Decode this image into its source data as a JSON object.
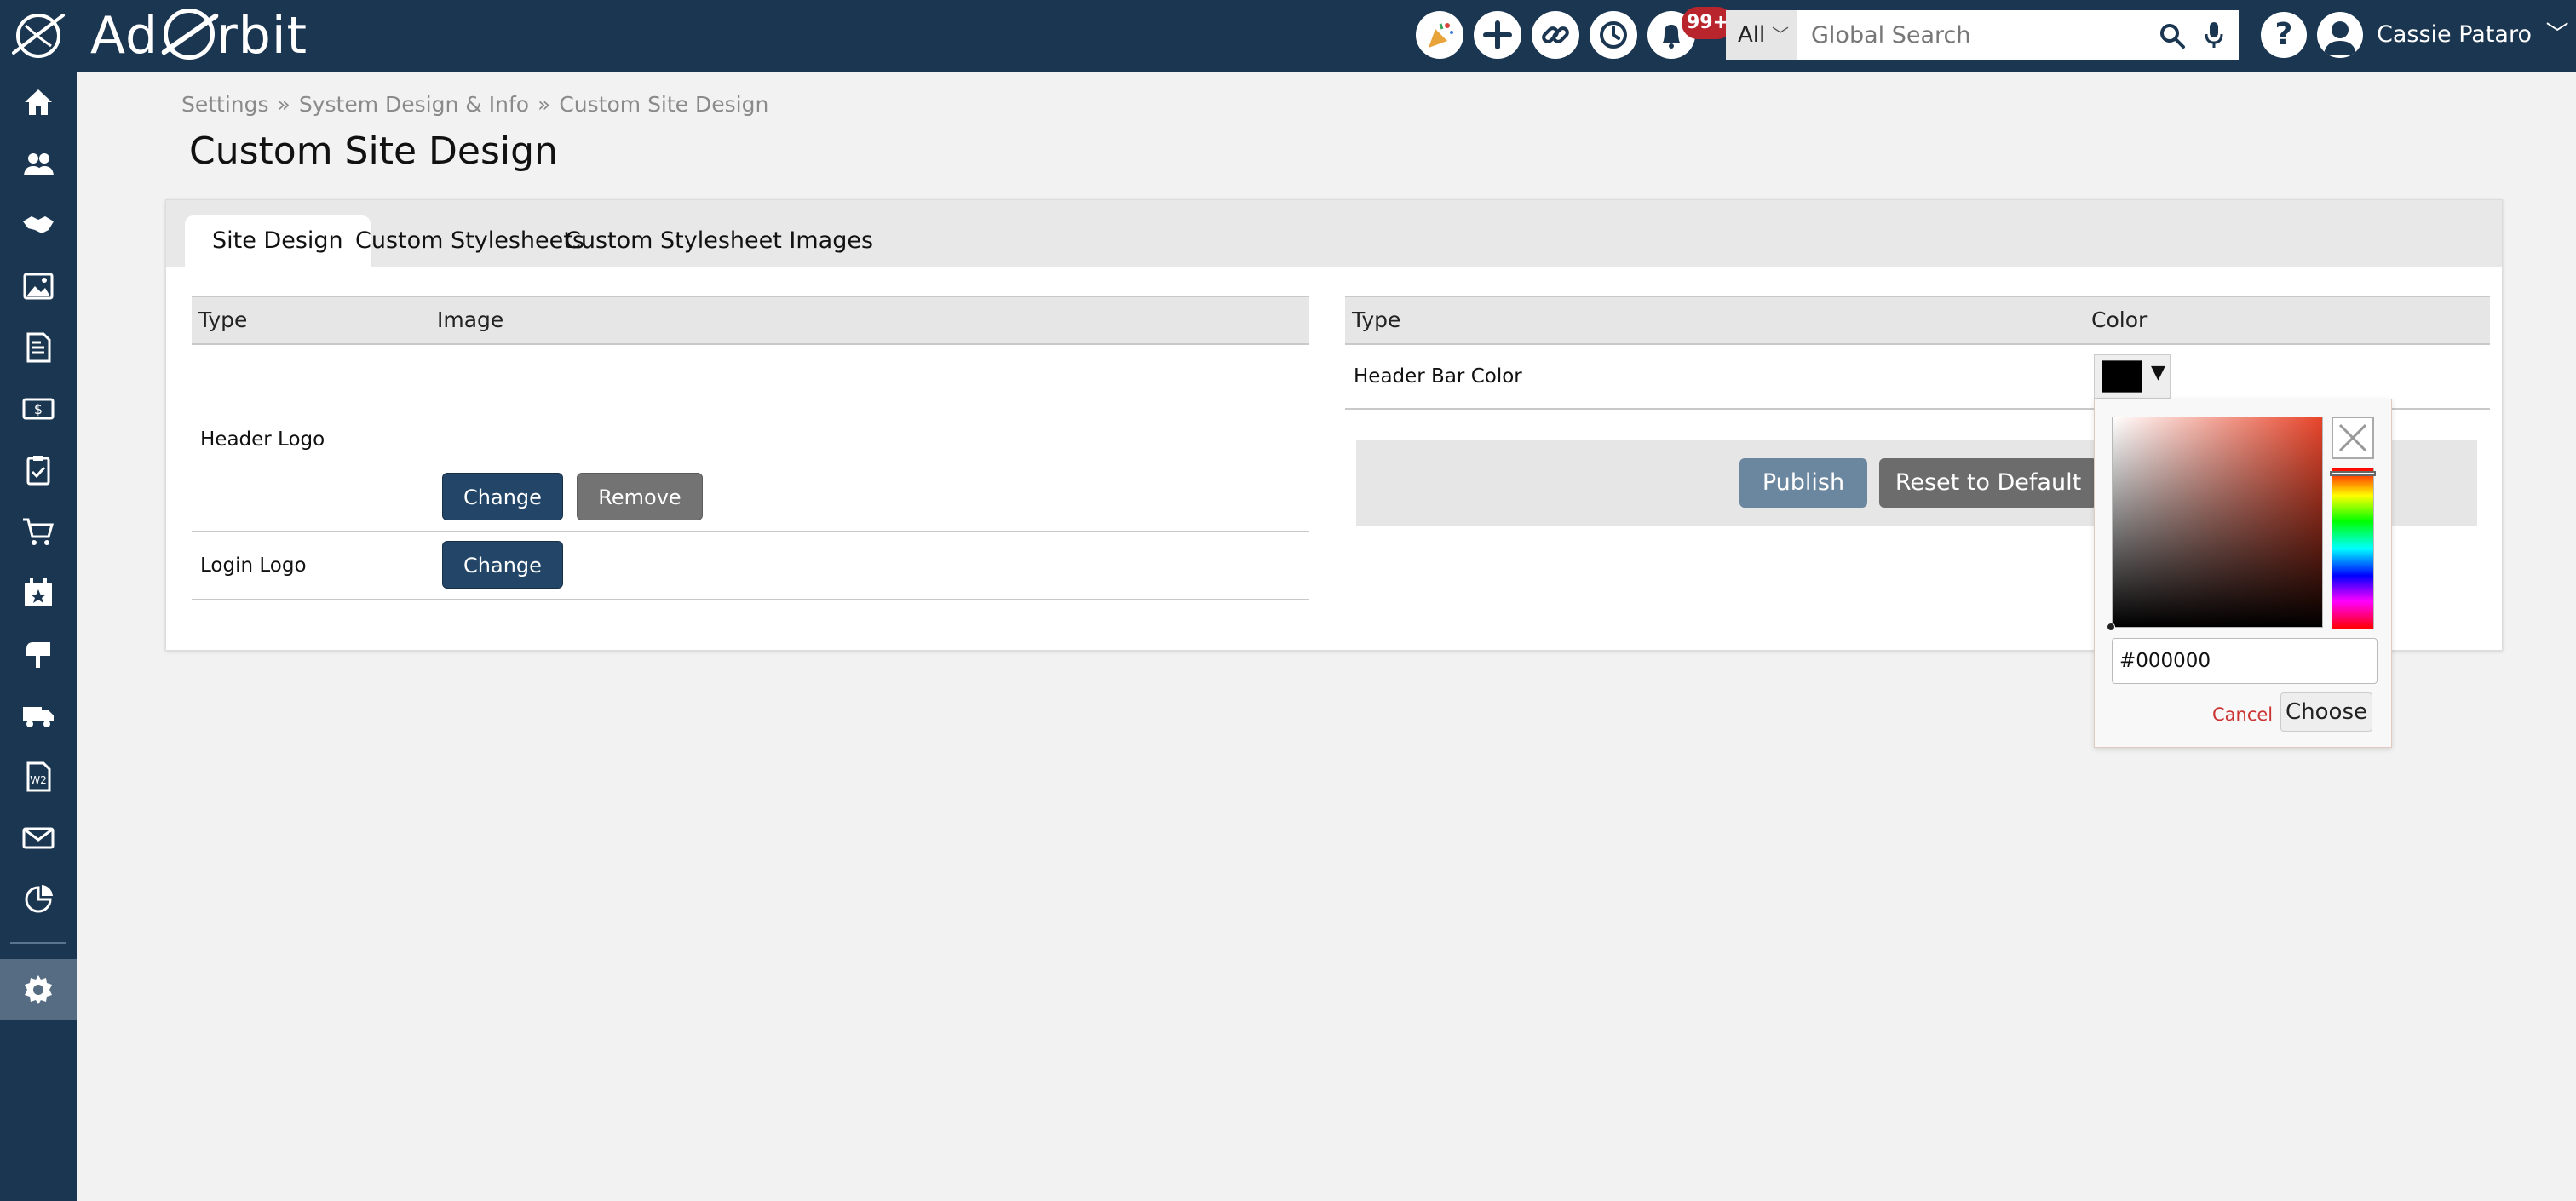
{
  "app": {
    "logo_text_left": "Ad",
    "logo_text_right": "rbit",
    "colors": {
      "header_bg": "#1b3651",
      "badge": "#b9252d",
      "primary_button": "#234668"
    }
  },
  "topbar": {
    "notifications_badge": "99+",
    "search": {
      "scope": "All",
      "placeholder": "Global Search"
    },
    "help_label": "?",
    "user_name": "Cassie Pataro",
    "icons": [
      "celebration-icon",
      "plus-icon",
      "link-icon",
      "history-icon",
      "bell-icon",
      "search-icon",
      "microphone-icon",
      "help-icon",
      "avatar-icon",
      "chevron-down-icon"
    ]
  },
  "sidebar": {
    "items": [
      "home-icon",
      "users-icon",
      "handshake-icon",
      "image-icon",
      "invoice-icon",
      "money-icon",
      "clipboard-icon",
      "cart-icon",
      "calendar-star-icon",
      "mailbox-icon",
      "truck-icon",
      "w2-form-icon",
      "envelope-icon",
      "pie-chart-icon",
      "gear-icon"
    ]
  },
  "breadcrumb": {
    "items": [
      "Settings",
      "System Design & Info",
      "Custom Site Design"
    ],
    "separator": "»"
  },
  "page": {
    "title": "Custom Site Design"
  },
  "tabs": [
    {
      "label": "Site Design",
      "active": true
    },
    {
      "label": "Custom Stylesheets",
      "active": false
    },
    {
      "label": "Custom Stylesheet Images",
      "active": false
    }
  ],
  "images_table": {
    "headers": [
      "Type",
      "Image"
    ],
    "rows": [
      {
        "type": "Header Logo",
        "change_label": "Change",
        "remove_label": "Remove"
      },
      {
        "type": "Login Logo",
        "change_label": "Change"
      }
    ]
  },
  "colors_table": {
    "headers": [
      "Type",
      "Color"
    ],
    "rows": [
      {
        "type": "Header Bar Color",
        "value": "#000000"
      }
    ]
  },
  "actions": {
    "publish_label": "Publish",
    "reset_label": "Reset to Default"
  },
  "color_picker": {
    "hex_value": "#000000",
    "cancel_label": "Cancel",
    "choose_label": "Choose"
  }
}
